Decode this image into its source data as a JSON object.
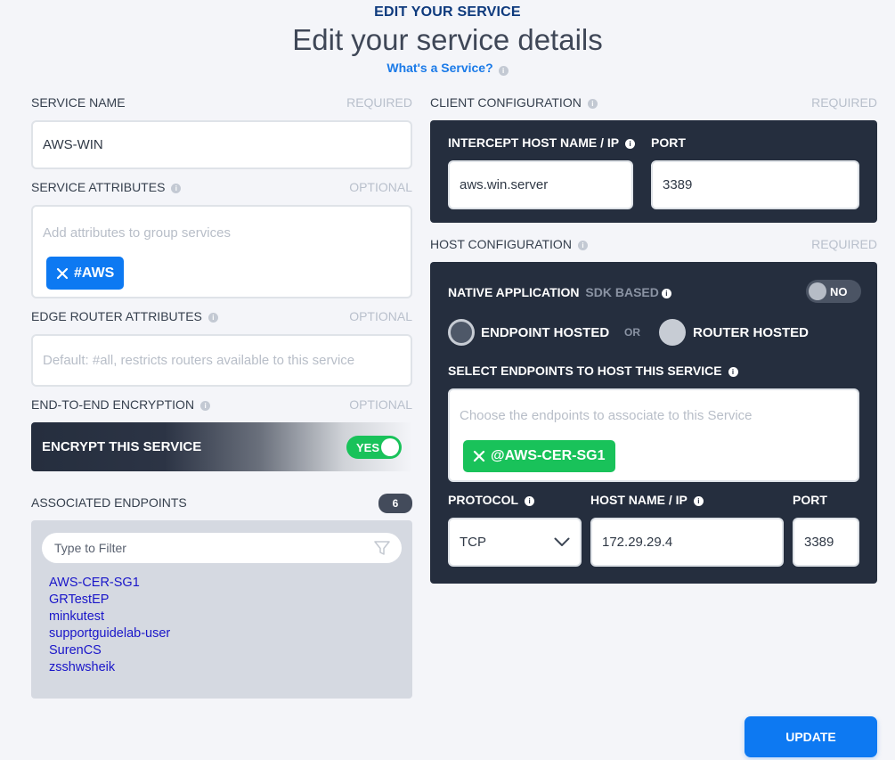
{
  "header": {
    "kicker": "EDIT YOUR SERVICE",
    "title": "Edit your service details",
    "help_link": "What's a Service?"
  },
  "service_name": {
    "label": "SERVICE NAME",
    "requirement": "REQUIRED",
    "value": "AWS-WIN"
  },
  "service_attributes": {
    "label": "SERVICE ATTRIBUTES",
    "requirement": "OPTIONAL",
    "placeholder": "Add attributes to group services",
    "chips": [
      "#AWS"
    ]
  },
  "edge_router_attributes": {
    "label": "EDGE ROUTER ATTRIBUTES",
    "requirement": "OPTIONAL",
    "placeholder": "Default: #all, restricts routers available to this service"
  },
  "encryption": {
    "label": "END-TO-END ENCRYPTION",
    "requirement": "OPTIONAL",
    "toggle_label": "ENCRYPT THIS SERVICE",
    "toggle_state": "YES"
  },
  "associated_endpoints": {
    "label": "ASSOCIATED ENDPOINTS",
    "count": "6",
    "filter_placeholder": "Type to Filter",
    "items": [
      "AWS-CER-SG1",
      "GRTestEP",
      "minkutest",
      "supportguidelab-user",
      "SurenCS",
      "zsshwsheik"
    ]
  },
  "client_configuration": {
    "label": "CLIENT CONFIGURATION",
    "requirement": "REQUIRED",
    "intercept_label": "INTERCEPT HOST NAME / IP",
    "intercept_value": "aws.win.server",
    "port_label": "PORT",
    "port_value": "3389"
  },
  "host_configuration": {
    "label": "HOST CONFIGURATION",
    "requirement": "REQUIRED",
    "native_label": "NATIVE APPLICATION",
    "native_sub": "SDK BASED",
    "native_toggle": "NO",
    "endpoint_hosted": "ENDPOINT HOSTED",
    "or_text": "OR",
    "router_hosted": "ROUTER HOSTED",
    "select_label": "SELECT ENDPOINTS TO HOST THIS SERVICE",
    "select_placeholder": "Choose the endpoints to associate to this Service",
    "chips": [
      "@AWS-CER-SG1"
    ],
    "protocol_label": "PROTOCOL",
    "protocol_value": "TCP",
    "host_label": "HOST NAME / IP",
    "host_value": "172.29.29.4",
    "port_label": "PORT",
    "port_value": "3389"
  },
  "actions": {
    "update": "UPDATE"
  },
  "colors": {
    "accent": "#0d79f2",
    "dark_panel": "#252e3e",
    "chip_blue": "#0d79f2",
    "chip_green": "#19c25a",
    "toggle_on": "#19c25a"
  }
}
